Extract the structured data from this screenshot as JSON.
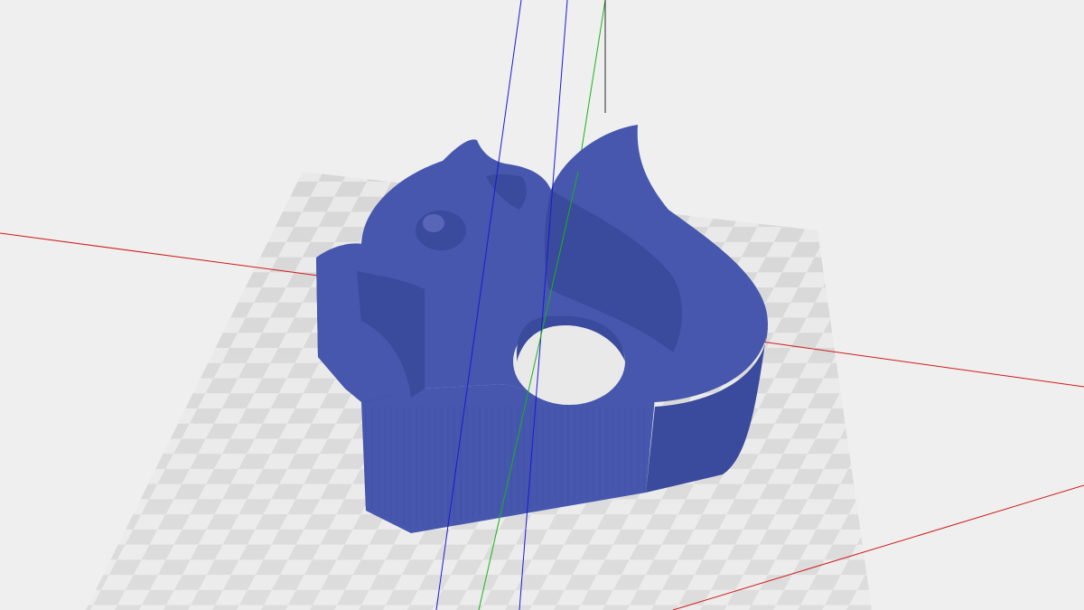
{
  "viewport": {
    "kind": "3d-model-preview",
    "background": "#efefef",
    "model": {
      "name": "squirrel-shaped-extrusion",
      "color": "#4657ad",
      "shade_color": "#3a4a9c",
      "highlight_color": "#5866b8"
    },
    "floor": {
      "pattern": "checkerboard",
      "dark_color": "#d6d6d6",
      "light_color": "#e9e9e9"
    },
    "axes": {
      "x_color": "#d11a1a",
      "y_color": "#18b418",
      "z_color": "#1a1ad6"
    }
  }
}
